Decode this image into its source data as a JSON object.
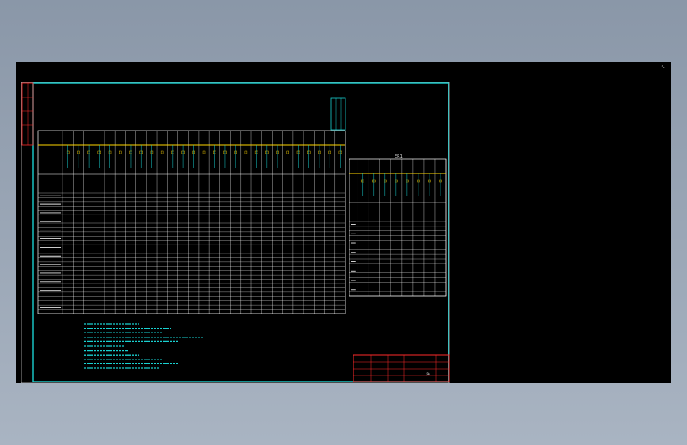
{
  "drawing": {
    "colors": {
      "frame": "#19d1d1",
      "grid": "#ffffff",
      "accent": "#ffd600",
      "title_block": "#ff2a2a",
      "text": "#e8e8e8",
      "background": "#000000"
    },
    "main_table": {
      "columns": 27,
      "rows": 28
    },
    "side_table": {
      "columns": 8,
      "rows": 16
    },
    "side_title": "ER1",
    "bottom_sheet_label": "(9)",
    "crosshair_glyph": "↖"
  }
}
